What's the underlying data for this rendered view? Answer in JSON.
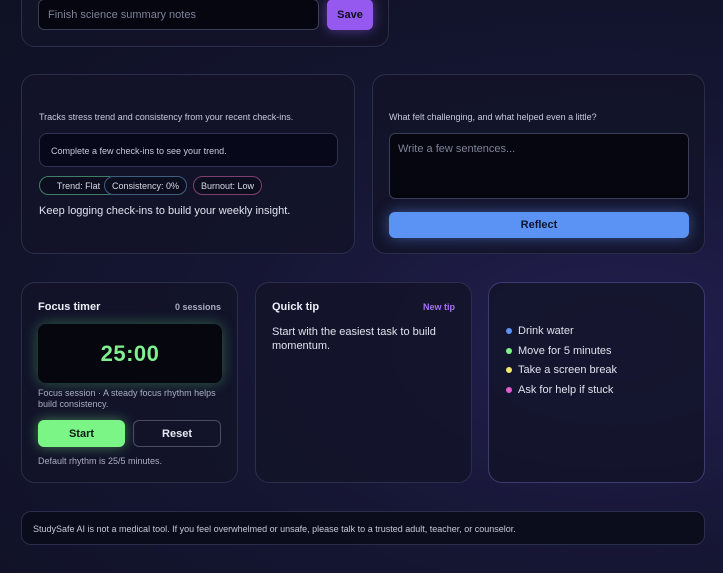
{
  "task": {
    "input_placeholder": "Finish science summary notes",
    "save_label": "Save"
  },
  "insight": {
    "description": "Tracks stress trend and consistency from your recent check-ins.",
    "trend_message": "Complete a few check-ins to see your trend.",
    "pills": {
      "trend": "Trend: Flat",
      "consistency": "Consistency: 0%",
      "burnout": "Burnout: Low"
    },
    "note": "Keep logging check-ins to build your weekly insight."
  },
  "reflect": {
    "prompt": "What felt challenging, and what helped even a little?",
    "placeholder": "Write a few sentences...",
    "button_label": "Reflect"
  },
  "timer": {
    "title": "Focus timer",
    "sessions": "0 sessions",
    "display": "25:00",
    "description": "Focus session · A steady focus rhythm helps build consistency.",
    "start_label": "Start",
    "reset_label": "Reset",
    "footer": "Default rhythm is 25/5 minutes."
  },
  "tip": {
    "title": "Quick tip",
    "new_tip_label": "New tip",
    "text": "Start with the easiest task to build momentum."
  },
  "wellness": {
    "items": [
      {
        "label": "Drink water",
        "color": "#5b93f4"
      },
      {
        "label": "Move for 5 minutes",
        "color": "#7cf587"
      },
      {
        "label": "Take a screen break",
        "color": "#f2e86b"
      },
      {
        "label": "Ask for help if stuck",
        "color": "#e05ad0"
      }
    ]
  },
  "disclaimer": "StudySafe AI is not a medical tool. If you feel overwhelmed or unsafe, please talk to a trusted adult, teacher, or counselor.",
  "colors": {
    "accent_purple": "#9659f0",
    "accent_blue": "#5b93f4",
    "accent_green": "#7cf587"
  }
}
